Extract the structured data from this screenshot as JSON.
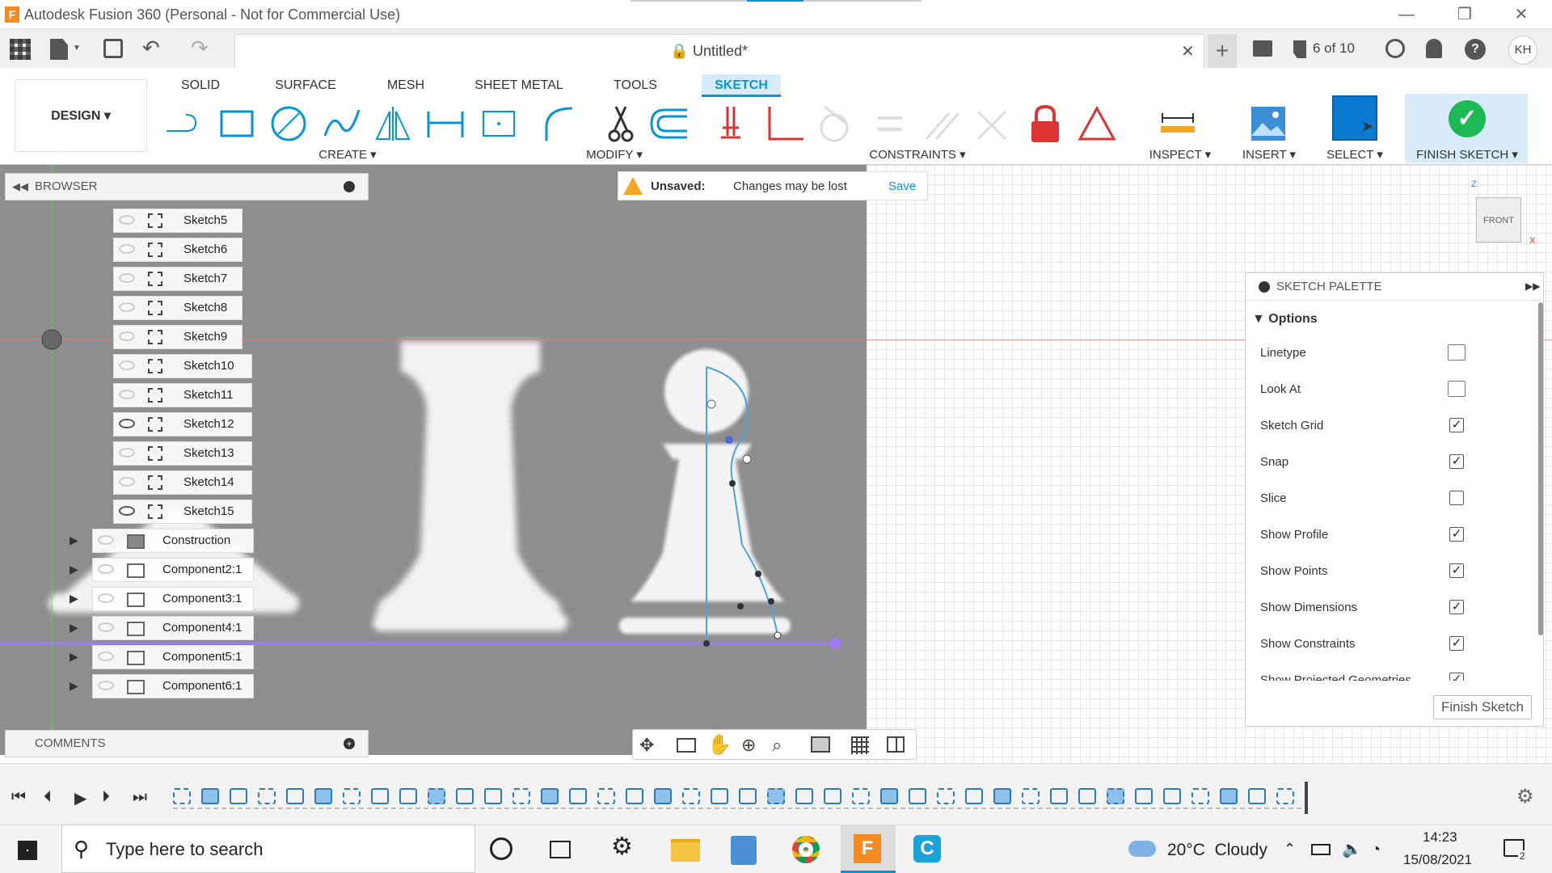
{
  "window": {
    "title": "Autodesk Fusion 360 (Personal - Not for Commercial Use)"
  },
  "qat": {
    "doc_title": "Untitled*",
    "jobs": "6 of 10",
    "user": "KH"
  },
  "ribbon": {
    "design": "DESIGN",
    "tabs": [
      "SOLID",
      "SURFACE",
      "MESH",
      "SHEET METAL",
      "TOOLS",
      "SKETCH"
    ],
    "groups": {
      "create": "CREATE",
      "modify": "MODIFY",
      "constraints": "CONSTRAINTS",
      "inspect": "INSPECT",
      "insert": "INSERT",
      "select": "SELECT",
      "finish": "FINISH SKETCH"
    }
  },
  "browser": {
    "title": "BROWSER",
    "sketches": [
      "Sketch5",
      "Sketch6",
      "Sketch7",
      "Sketch8",
      "Sketch9",
      "Sketch10",
      "Sketch11",
      "Sketch12",
      "Sketch13",
      "Sketch14",
      "Sketch15"
    ],
    "nodes": [
      "Construction",
      "Component2:1",
      "Component3:1",
      "Component4:1",
      "Component5:1",
      "Component6:1"
    ]
  },
  "comments": {
    "title": "COMMENTS"
  },
  "unsaved": {
    "label": "Unsaved:",
    "message": "Changes may be lost",
    "save": "Save"
  },
  "viewcube": {
    "face": "FRONT",
    "axis_z": "Z",
    "axis_x": "X"
  },
  "palette": {
    "title": "SKETCH PALETTE",
    "section": "Options",
    "rows": [
      {
        "label": "Linetype"
      },
      {
        "label": "Look At"
      },
      {
        "label": "Sketch Grid",
        "checked": true
      },
      {
        "label": "Snap",
        "checked": true
      },
      {
        "label": "Slice",
        "checked": false
      },
      {
        "label": "Show Profile",
        "checked": true
      },
      {
        "label": "Show Points",
        "checked": true
      },
      {
        "label": "Show Dimensions",
        "checked": true
      },
      {
        "label": "Show Constraints",
        "checked": true
      },
      {
        "label": "Show Projected Geometries",
        "checked": true
      }
    ],
    "finish": "Finish Sketch"
  },
  "taskbar": {
    "search_placeholder": "Type here to search",
    "weather": "20°C  Cloudy",
    "time": "14:23",
    "date": "15/08/2021",
    "notifications": "2"
  },
  "colors": {
    "accent": "#0696d7",
    "finish_green": "#1db954",
    "photo_gray": "#8e8e8e"
  }
}
